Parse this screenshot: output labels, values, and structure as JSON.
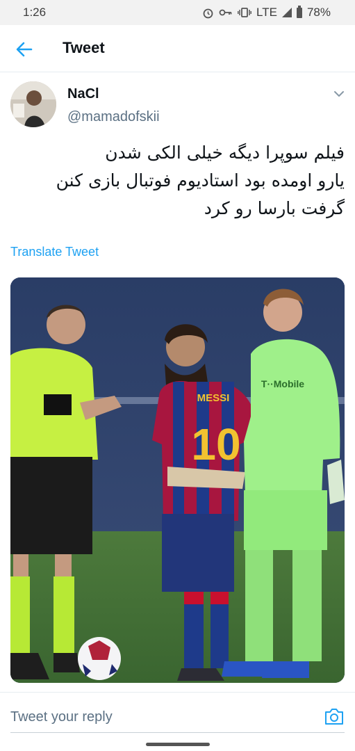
{
  "status_bar": {
    "time": "1:26",
    "network": "LTE",
    "battery": "78%",
    "icons": [
      "alarm-icon",
      "key-icon",
      "vibrate-icon",
      "signal-icon",
      "battery-icon"
    ]
  },
  "header": {
    "title": "Tweet",
    "back_icon": "arrow-left-icon"
  },
  "tweet": {
    "author_name": "NaCl",
    "author_handle": "@mamadofskii",
    "text_lines": [
      "فیلم سوپرا دیگه خیلی الکی شدن",
      "یارو اومده بود استادیوم فوتبال بازی کنن",
      "گرفت بارسا رو کرد"
    ],
    "translate_label": "Translate Tweet",
    "media": {
      "jersey_name": "MESSI",
      "jersey_number": "10",
      "gk_text": "T··Mobile"
    }
  },
  "reply": {
    "placeholder": "Tweet your reply",
    "camera_icon": "camera-icon"
  },
  "colors": {
    "accent": "#1da1f2",
    "secondary_text": "#5b7083",
    "status_bar_bg": "#f2f2f2"
  }
}
